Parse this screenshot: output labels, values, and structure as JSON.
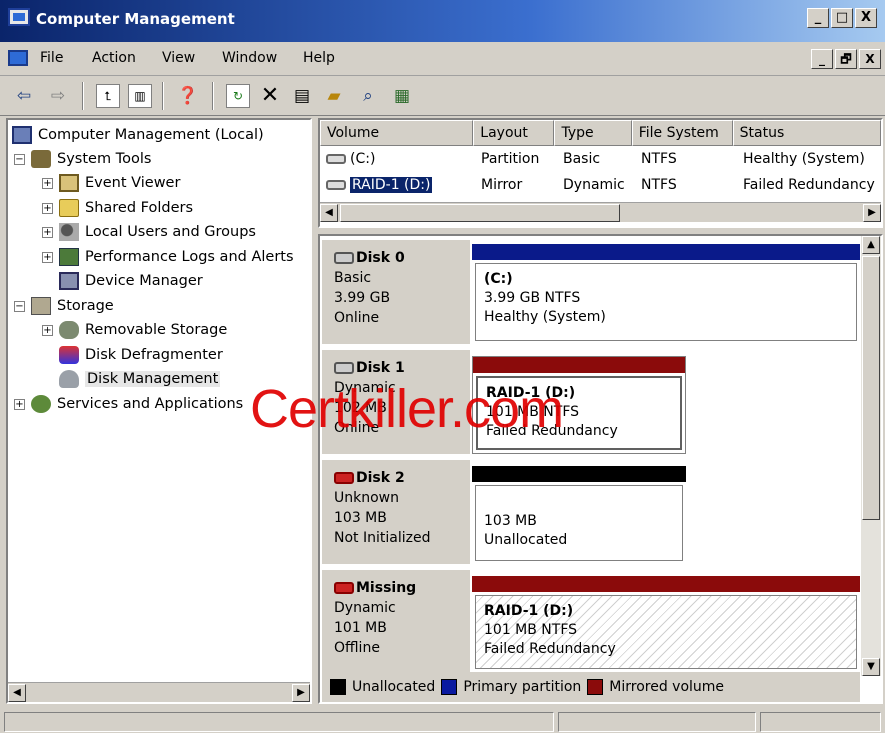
{
  "window": {
    "title": "Computer Management",
    "controls": [
      "_",
      "□",
      "X"
    ],
    "mdi_controls": [
      "_",
      "🗗",
      "X"
    ]
  },
  "menu": [
    "File",
    "Action",
    "View",
    "Window",
    "Help"
  ],
  "toolbar_icons": [
    "back-icon",
    "forward-icon",
    "up-folder-icon",
    "show-hide-tree-icon",
    "help-icon",
    "refresh-icon",
    "delete-icon",
    "properties-icon",
    "open-icon",
    "search-icon",
    "settings-icon"
  ],
  "tree": [
    {
      "label": "Computer Management (Local)",
      "level": 0,
      "icon": "computer-icon"
    },
    {
      "label": "System Tools",
      "level": 1,
      "expander": "−",
      "icon": "tools-icon"
    },
    {
      "label": "Event Viewer",
      "level": 2,
      "expander": "+",
      "icon": "event-viewer-icon"
    },
    {
      "label": "Shared Folders",
      "level": 2,
      "expander": "+",
      "icon": "shared-folder-icon"
    },
    {
      "label": "Local Users and Groups",
      "level": 2,
      "expander": "+",
      "icon": "users-icon"
    },
    {
      "label": "Performance Logs and Alerts",
      "level": 2,
      "expander": "+",
      "icon": "performance-icon"
    },
    {
      "label": "Device Manager",
      "level": 2,
      "icon": "device-manager-icon"
    },
    {
      "label": "Storage",
      "level": 1,
      "expander": "−",
      "icon": "storage-icon"
    },
    {
      "label": "Removable Storage",
      "level": 2,
      "expander": "+",
      "icon": "removable-storage-icon"
    },
    {
      "label": "Disk Defragmenter",
      "level": 2,
      "icon": "defrag-icon"
    },
    {
      "label": "Disk Management",
      "level": 2,
      "icon": "disk-management-icon",
      "selected": true
    },
    {
      "label": "Services and Applications",
      "level": 1,
      "expander": "+",
      "icon": "services-icon"
    }
  ],
  "volumes": {
    "columns": [
      "Volume",
      "Layout",
      "Type",
      "File System",
      "Status"
    ],
    "rows": [
      {
        "volume": "(C:)",
        "layout": "Partition",
        "type": "Basic",
        "fs": "NTFS",
        "status": "Healthy (System)"
      },
      {
        "volume": "RAID-1 (D:)",
        "layout": "Mirror",
        "type": "Dynamic",
        "fs": "NTFS",
        "status": "Failed Redundancy",
        "selected": true
      }
    ]
  },
  "disks": [
    {
      "name": "Disk 0",
      "lines": [
        "Basic",
        "3.99 GB",
        "Online"
      ],
      "partition": {
        "title": "(C:)",
        "lines": [
          "3.99 GB NTFS",
          "Healthy (System)"
        ],
        "color": "#0a1a8a"
      }
    },
    {
      "name": "Disk 1",
      "lines": [
        "Dynamic",
        "102 MB",
        "Online"
      ],
      "partition": {
        "title": "RAID-1  (D:)",
        "lines": [
          "101 MB NTFS",
          "Failed Redundancy"
        ],
        "color": "#8b0b0b"
      }
    },
    {
      "name": "Disk 2",
      "lines": [
        "Unknown",
        "103 MB",
        "Not Initialized"
      ],
      "partition": {
        "title": "",
        "lines": [
          "103 MB",
          "Unallocated"
        ],
        "color": "#000000"
      }
    },
    {
      "name": "Missing",
      "lines": [
        "Dynamic",
        "101 MB",
        "Offline"
      ],
      "partition": {
        "title": "RAID-1  (D:)",
        "lines": [
          "101 MB NTFS",
          "Failed Redundancy"
        ],
        "color": "#8b0b0b"
      }
    }
  ],
  "legend": [
    {
      "label": "Unallocated",
      "color": "#000000"
    },
    {
      "label": "Primary partition",
      "color": "#0a1aa0"
    },
    {
      "label": "Mirrored volume",
      "color": "#8b0b0b"
    }
  ],
  "watermark": "Certkiller.com"
}
